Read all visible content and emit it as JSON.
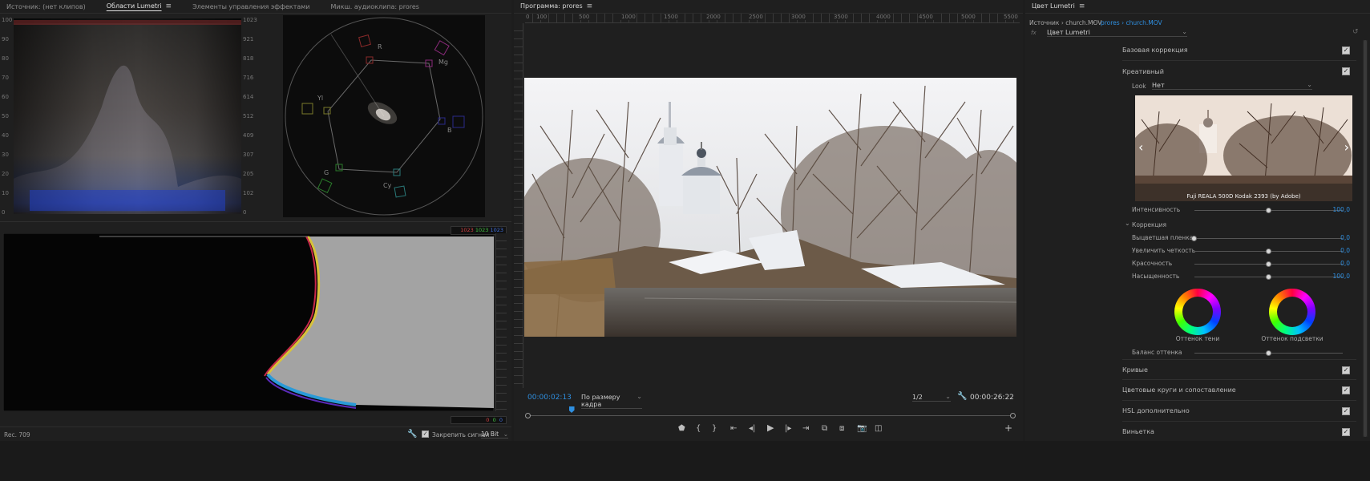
{
  "scopes_panel": {
    "tabs": [
      {
        "label": "Источник: (нет клипов)",
        "active": false
      },
      {
        "label": "Области Lumetri",
        "active": true
      },
      {
        "label": "Элементы управления эффектами",
        "active": false
      },
      {
        "label": "Микш. аудиоклипа: prores",
        "active": false
      }
    ],
    "waveform_left_scale": [
      "100",
      "90",
      "80",
      "70",
      "60",
      "50",
      "40",
      "30",
      "20",
      "10",
      "0"
    ],
    "waveform_right_scale": [
      "1023",
      "921",
      "818",
      "716",
      "614",
      "512",
      "409",
      "307",
      "205",
      "102",
      "0"
    ],
    "vectorscope_labels": {
      "r": "R",
      "mg": "Mg",
      "b": "B",
      "cy": "Cy",
      "g": "G",
      "yl": "Yl"
    },
    "histogram_values": {
      "r": "1023",
      "g": "1023",
      "b": "1023"
    },
    "histogram_bottom_values": {
      "r": "0",
      "g": "0",
      "b": "0"
    },
    "status_left": "Rec. 709",
    "clamp_label": "Закрепить сигнал",
    "bit_depth": "10 Bit"
  },
  "program_panel": {
    "title": "Программа: prores",
    "ruler_labels": [
      "0",
      "100",
      "500",
      "1000",
      "1500",
      "2000",
      "2500",
      "3000",
      "3500",
      "4000",
      "4500",
      "5000",
      "5500"
    ],
    "timecode_current": "00:00:02:13",
    "zoom_option": "По размеру кадра",
    "resolution": "1/2",
    "timecode_duration": "00:00:26:22",
    "playhead_fraction": 0.09
  },
  "lumetri_panel": {
    "title": "Цвет Lumetri",
    "source_label": "Источник › church.MOV",
    "sequence_label": "prores › church.MOV",
    "effect_name": "Цвет Lumetri",
    "sections": {
      "basic": "Базовая коррекция",
      "creative": "Креативный",
      "curves": "Кривые",
      "color_wheels": "Цветовые круги и сопоставление",
      "hsl": "HSL дополнительно",
      "vignette": "Виньетка"
    },
    "look_label": "Look",
    "look_value": "Нет",
    "preview_caption": "Fuji REALA 500D Kodak 2393 (by Adobe)",
    "intensity_label": "Интенсивность",
    "intensity_value": "100,0",
    "correction_label": "Коррекция",
    "sliders": [
      {
        "label": "Выцветшая пленка",
        "value": "0,0",
        "fraction": 0.0
      },
      {
        "label": "Увеличить четкость",
        "value": "0,0",
        "fraction": 0.5
      },
      {
        "label": "Красочность",
        "value": "0,0",
        "fraction": 0.5
      },
      {
        "label": "Насыщенность",
        "value": "100,0",
        "fraction": 0.5
      }
    ],
    "shadow_tint_label": "Оттенок тени",
    "highlight_tint_label": "Оттенок подсветки",
    "tint_balance_label": "Баланс оттенка",
    "tint_balance_fraction": 0.5,
    "intensity_fraction": 0.5
  },
  "colors": {
    "accent_blue": "#2f8fe0",
    "panel_bg": "#232323",
    "app_bg": "#1d1d1d"
  }
}
